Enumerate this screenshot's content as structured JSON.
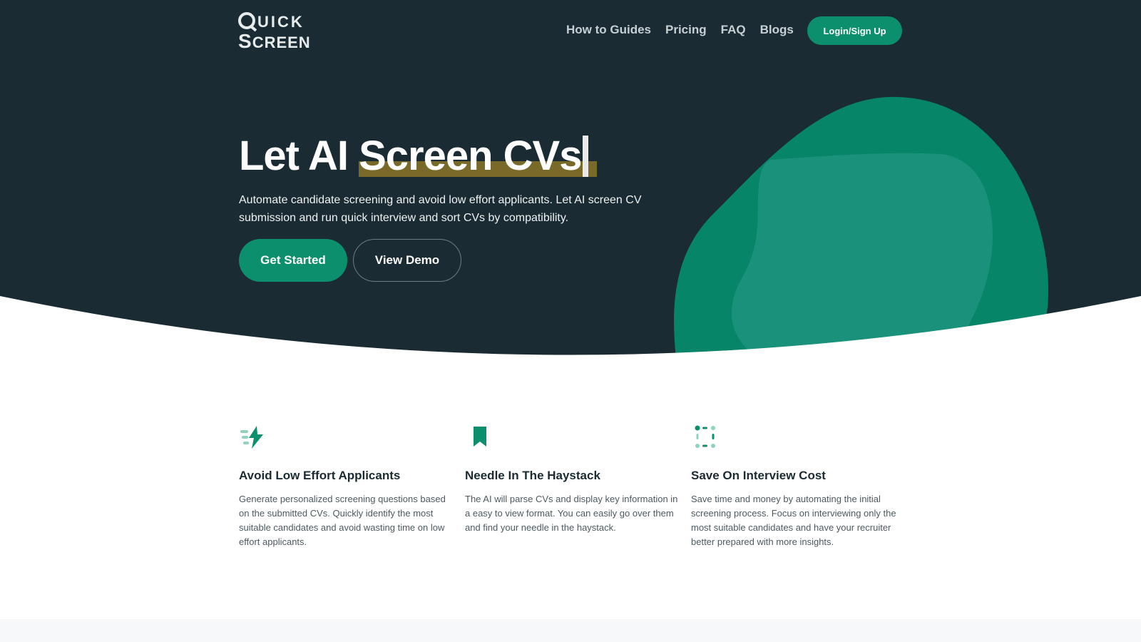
{
  "nav": {
    "logo_line1_initial": "Q",
    "logo_line1_rest": "UICK",
    "logo_line2_initial": "S",
    "logo_line2_rest": "CREEN",
    "links": [
      "How to Guides",
      "Pricing",
      "FAQ",
      "Blogs"
    ],
    "login_label": "Login/Sign Up"
  },
  "hero": {
    "headline_plain": "Let AI ",
    "headline_highlight": "Screen CVs",
    "subtitle": "Automate candidate screening and avoid low effort applicants. Let AI screen CV submission and run quick interview and sort CVs by compatibility.",
    "primary_cta": "Get Started",
    "secondary_cta": "View Demo"
  },
  "features": [
    {
      "icon": "lightning-bolt-icon",
      "title": "Avoid Low Effort Applicants",
      "description": "Generate personalized screening questions based on the submitted CVs. Quickly identify the most suitable candidates and avoid wasting time on low effort applicants."
    },
    {
      "icon": "bookmark-icon",
      "title": "Needle In The Haystack",
      "description": "The AI will parse CVs and display key information in a easy to view format. You can easily go over them and find your needle in the haystack."
    },
    {
      "icon": "dotted-square-icon",
      "title": "Save On Interview Cost",
      "description": "Save time and money by automating the initial screening process. Focus on interviewing only the most suitable candidates and have your recruiter better prepared with more insights."
    }
  ],
  "colors": {
    "hero_bg": "#1b2b33",
    "accent": "#0c8f6c",
    "highlight": "#7a6a2a",
    "blob_dark": "#078568",
    "blob_light": "#1a917b"
  }
}
